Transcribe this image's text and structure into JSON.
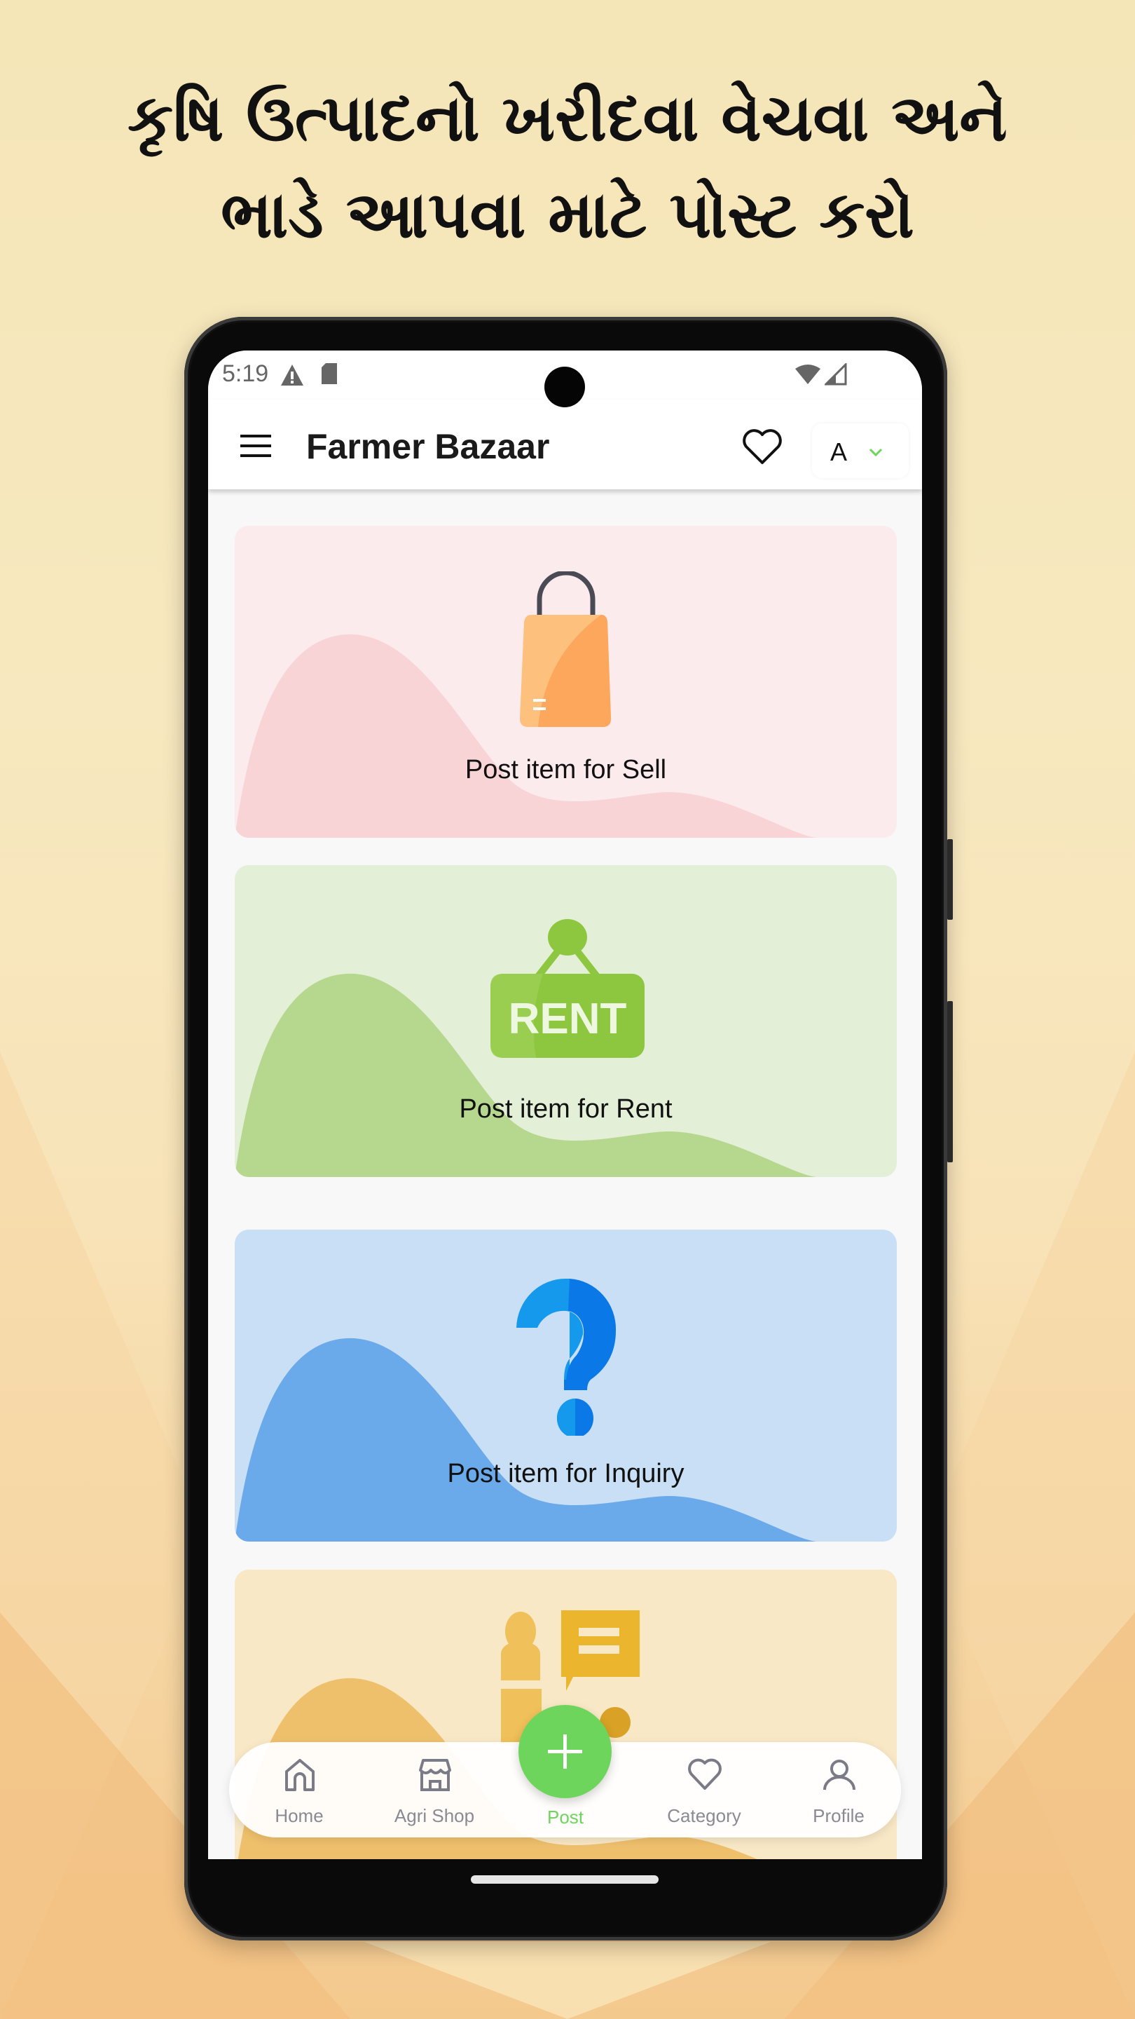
{
  "headline": {
    "line1": "કૃષિ ઉત્પાદનો ખરીદવા વેચવા અને",
    "line2": "ભાડે આપવા માટે પોસ્ટ કરો"
  },
  "status_bar": {
    "time": "5:19",
    "left_icons": [
      "alert-icon",
      "sd-card-icon"
    ],
    "right_icons": [
      "wifi-icon",
      "signal-icon"
    ]
  },
  "app_bar": {
    "menu_icon": "hamburger-menu-icon",
    "title": "Farmer Bazaar",
    "favorite_icon": "heart-outline-icon",
    "language_selector": {
      "value": "A",
      "icon": "chevron-down-icon"
    }
  },
  "cards": [
    {
      "label": "Post item for Sell",
      "icon": "shopping-bag-icon",
      "bg": "#fbebec",
      "wave": "#f9d4d6"
    },
    {
      "label": "Post item for Rent",
      "icon": "rent-sign-icon",
      "icon_text": "RENT",
      "bg": "#e3efd7",
      "wave": "#b5d88e"
    },
    {
      "label": "Post item for Inquiry",
      "icon": "question-mark-icon",
      "bg": "#c8dff5",
      "wave": "#6aa9ea"
    },
    {
      "label": "",
      "icon": "user-chat-icon",
      "bg": "#f8e8c6",
      "wave": "#efc06c"
    }
  ],
  "bottom_nav": {
    "items": [
      {
        "label": "Home",
        "icon": "home-icon",
        "active": false
      },
      {
        "label": "Agri Shop",
        "icon": "store-icon",
        "active": false
      },
      {
        "label": "Post",
        "icon": "plus-icon",
        "active": true
      },
      {
        "label": "Category",
        "icon": "heart-icon",
        "active": false
      },
      {
        "label": "Profile",
        "icon": "user-icon",
        "active": false
      }
    ],
    "active_color": "#6ed55c",
    "inactive_color": "#8a8a95"
  }
}
